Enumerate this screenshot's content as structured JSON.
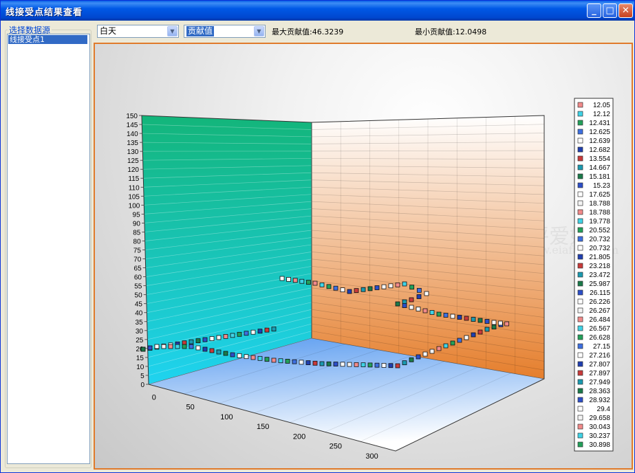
{
  "window": {
    "title": "线接受点结果查看"
  },
  "sidebar": {
    "group_label": "选择数据源",
    "items": [
      {
        "label": "线接受点1",
        "selected": true
      }
    ]
  },
  "toolbar": {
    "period_select": {
      "value": "白天"
    },
    "metric_select": {
      "value": "贡献值"
    },
    "max_label": "最大贡献值:46.3239",
    "min_label": "最小贡献值:12.0498"
  },
  "watermark": {
    "line1": "环评爱好者",
    "line2": "www.eiafans.com"
  },
  "chart_data": {
    "type": "scatter",
    "view": "3d",
    "y_axis": {
      "min": 0,
      "max": 150,
      "step": 5,
      "ticks": [
        0,
        5,
        10,
        15,
        20,
        25,
        30,
        35,
        40,
        45,
        50,
        55,
        60,
        65,
        70,
        75,
        80,
        85,
        90,
        95,
        100,
        105,
        110,
        115,
        120,
        125,
        130,
        135,
        140,
        145,
        150
      ]
    },
    "x_axis": {
      "ticks": [
        0,
        50,
        100,
        150,
        200,
        250,
        300
      ]
    },
    "colors": {
      "wall_left_top": "#13b57a",
      "wall_left_bottom": "#1fd3f0",
      "wall_right_top": "#ffffff",
      "wall_right_bottom": "#e57e2c",
      "floor_back": "#5c9df0",
      "floor_front": "#ffffff"
    },
    "legend": [
      {
        "label": "12.05",
        "color": "#f28a8a"
      },
      {
        "label": "12.12",
        "color": "#3fd3e6"
      },
      {
        "label": "12.431",
        "color": "#22a05a"
      },
      {
        "label": "12.625",
        "color": "#3d6fe0"
      },
      {
        "label": "12.639",
        "color": "#ffffff"
      },
      {
        "label": "12.682",
        "color": "#1f3fb0"
      },
      {
        "label": "13.554",
        "color": "#c83a3a"
      },
      {
        "label": "14.667",
        "color": "#1a9ab0"
      },
      {
        "label": "15.181",
        "color": "#1a7a4a"
      },
      {
        "label": "15.23",
        "color": "#2c4fc8"
      },
      {
        "label": "17.625",
        "color": "#ffffff"
      },
      {
        "label": "18.788",
        "color": "#f4f4f4"
      },
      {
        "label": "18.788",
        "color": "#f28a8a"
      },
      {
        "label": "19.778",
        "color": "#3fd3e6"
      },
      {
        "label": "20.552",
        "color": "#22a05a"
      },
      {
        "label": "20.732",
        "color": "#3d6fe0"
      },
      {
        "label": "20.732",
        "color": "#ffffff"
      },
      {
        "label": "21.805",
        "color": "#1f3fb0"
      },
      {
        "label": "23.218",
        "color": "#c83a3a"
      },
      {
        "label": "23.472",
        "color": "#1a9ab0"
      },
      {
        "label": "25.987",
        "color": "#1a7a4a"
      },
      {
        "label": "26.115",
        "color": "#2c4fc8"
      },
      {
        "label": "26.226",
        "color": "#ffffff"
      },
      {
        "label": "26.267",
        "color": "#f4f4f4"
      },
      {
        "label": "26.484",
        "color": "#f28a8a"
      },
      {
        "label": "26.567",
        "color": "#3fd3e6"
      },
      {
        "label": "26.628",
        "color": "#22a05a"
      },
      {
        "label": "27.15",
        "color": "#3d6fe0"
      },
      {
        "label": "27.216",
        "color": "#ffffff"
      },
      {
        "label": "27.807",
        "color": "#1f3fb0"
      },
      {
        "label": "27.897",
        "color": "#c83a3a"
      },
      {
        "label": "27.949",
        "color": "#1a9ab0"
      },
      {
        "label": "28.363",
        "color": "#1a7a4a"
      },
      {
        "label": "28.932",
        "color": "#2c4fc8"
      },
      {
        "label": "29.4",
        "color": "#ffffff"
      },
      {
        "label": "29.658",
        "color": "#f4f4f4"
      },
      {
        "label": "30.043",
        "color": "#f28a8a"
      },
      {
        "label": "30.237",
        "color": "#3fd3e6"
      },
      {
        "label": "30.898",
        "color": "#22a05a"
      }
    ]
  }
}
